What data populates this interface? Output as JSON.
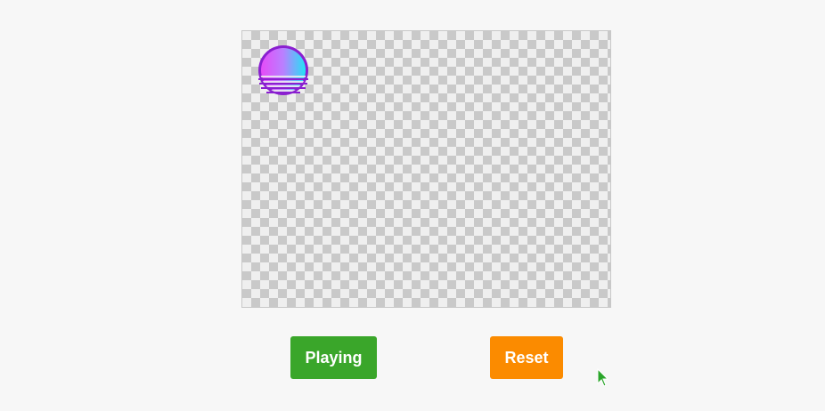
{
  "animation": {
    "sprite_icon": "synthwave-sun-icon",
    "sprite_gradient_left": "#e64cf7",
    "sprite_gradient_right": "#22e3f5",
    "sprite_outline": "#8a1fd0",
    "checker_light": "#efefef",
    "checker_dark": "#c9c9c9"
  },
  "controls": {
    "play_label": "Playing",
    "play_color": "#3aa62a",
    "reset_label": "Reset",
    "reset_color": "#fb8b00"
  },
  "cursor": {
    "icon": "mouse-pointer-icon",
    "color": "#2aa52a"
  }
}
